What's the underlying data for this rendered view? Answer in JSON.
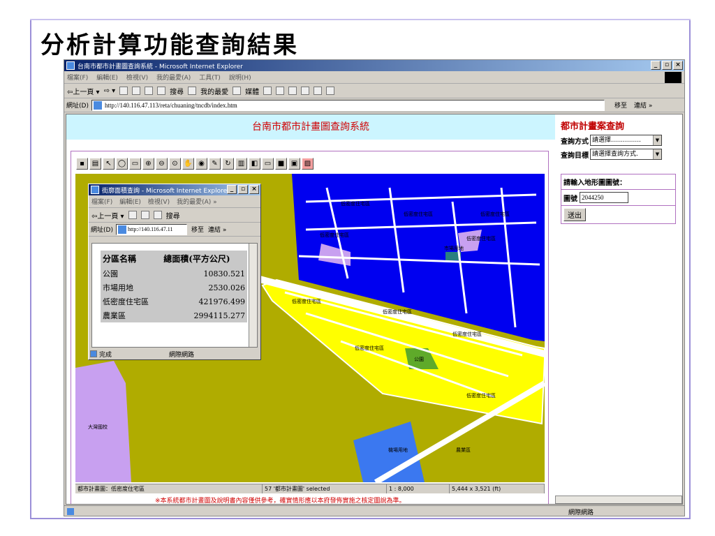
{
  "slide": {
    "title": "分析計算功能查詢結果"
  },
  "browser": {
    "title": "台南市都市計畫圖查詢系統 - Microsoft Internet Explorer",
    "menu": [
      "檔案(F)",
      "編輯(E)",
      "檢視(V)",
      "我的最愛(A)",
      "工具(T)",
      "說明(H)"
    ],
    "toolbar": {
      "back": "⇦上一頁 ▾",
      "search": "搜尋",
      "favorites": "我的最愛",
      "media": "媒體"
    },
    "address_label": "網址(D)",
    "url": "http://140.116.47.113/reta/chuaning/tncdb/index.htm",
    "go": "移至",
    "links": "連結 »",
    "status_net": "網際網路",
    "win_buttons": [
      "_",
      "▫",
      "×"
    ]
  },
  "page": {
    "banner": "台南市都市計畫圖查詢系統",
    "disclaimer": "※本系統都市計畫圖及說明書內容僅供參考，確實情形應以本府發佈實施之核定圖說為準。",
    "sidebar": {
      "title": "都市計畫案查詢",
      "query_method_label": "查詢方式",
      "query_method_value": "請選擇...............",
      "query_target_label": "查詢目標",
      "query_target_value": "請選擇查詢方式.",
      "input_header": "請輸入地形圖圖號：",
      "map_no_label": "圖號",
      "map_no_value": "2044250",
      "submit": "送出"
    },
    "map_status": [
      "都市計畫圖：低密度住宅區",
      "57 '都市計畫圖' selected",
      "1 : 8,000",
      "5,444 x 3,521 (ft)"
    ],
    "map_labels": {
      "zone": "低密度住宅區",
      "park": "公園",
      "market": "市場用地",
      "school": "大灣國校",
      "farm": "農業區",
      "airport": "機場用地"
    }
  },
  "popup": {
    "title": "街廓面積查詢 - Microsoft Internet Explorer",
    "menu": [
      "檔案(F)",
      "編輯(E)",
      "檢視(V)",
      "我的最愛(A) »"
    ],
    "back": "⇦上一頁 ▾",
    "search": "搜尋",
    "address_label": "網址(D)",
    "url": "http://140.116.47.11",
    "go": "移至",
    "links": "連結 »",
    "table": {
      "headers": [
        "分區名稱",
        "總面積(平方公尺)"
      ],
      "rows": [
        [
          "公園",
          "10830.521"
        ],
        [
          "市場用地",
          "2530.026"
        ],
        [
          "低密度住宅區",
          "421976.499"
        ],
        [
          "農業區",
          "2994115.277"
        ]
      ]
    },
    "status": "完成",
    "status_net": "網際網路"
  },
  "colors": {
    "residential_zone": "#ffff00",
    "agriculture": "#b0ac00",
    "park": "#5faa2a",
    "water_zone": "#0000f0",
    "special": "#c8a0f0",
    "airport": "#3b78f0"
  }
}
